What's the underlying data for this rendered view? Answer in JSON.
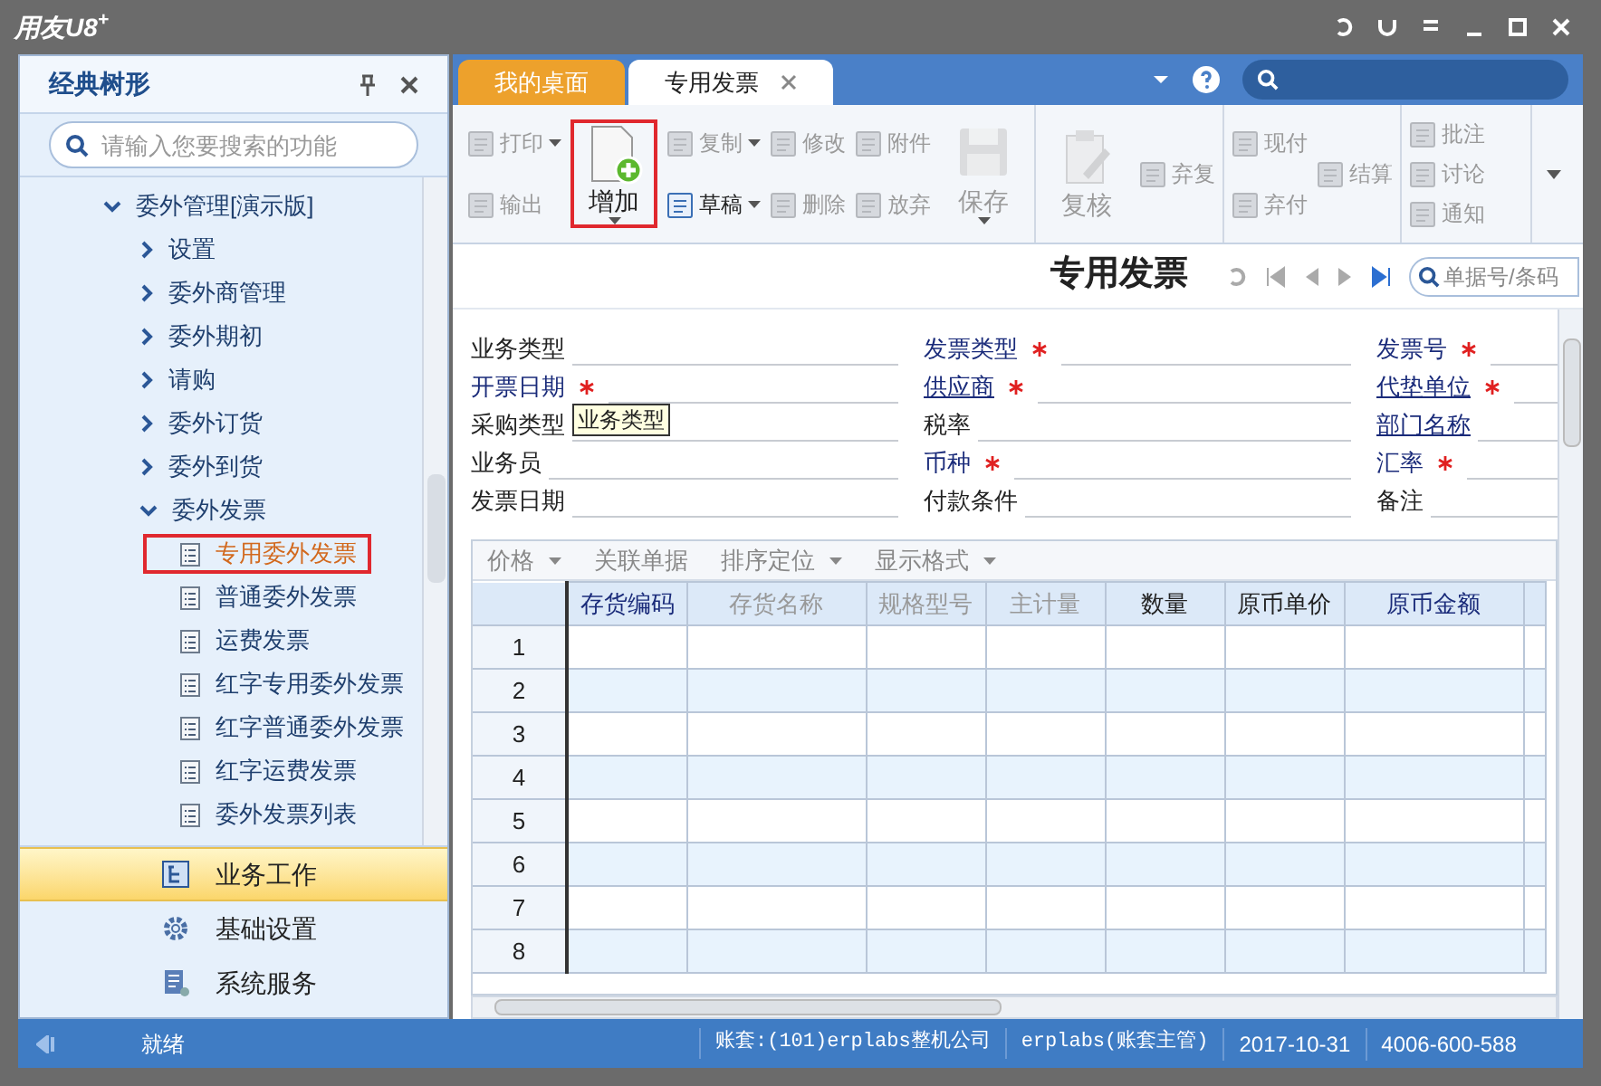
{
  "title_bar": {
    "app_title": "用友U8$^{+}$"
  },
  "sidebar": {
    "title": "经典树形",
    "search_placeholder": "请输入您要搜索的功能",
    "tree": [
      {
        "label": "委外管理[演示版]",
        "expanded": true,
        "children": [
          {
            "label": "设置",
            "expanded": false
          },
          {
            "label": "委外商管理",
            "expanded": false
          },
          {
            "label": "委外期初",
            "expanded": false
          },
          {
            "label": "请购",
            "expanded": false
          },
          {
            "label": "委外订货",
            "expanded": false
          },
          {
            "label": "委外到货",
            "expanded": false
          },
          {
            "label": "委外发票",
            "expanded": true,
            "children": [
              {
                "label": "专用委外发票",
                "kind": "document",
                "selected": true,
                "highlighted": true
              },
              {
                "label": "普通委外发票",
                "kind": "document",
                "selected": false,
                "highlighted": false
              },
              {
                "label": "运费发票",
                "kind": "document",
                "selected": false,
                "highlighted": false
              },
              {
                "label": "红字专用委外发票",
                "kind": "document",
                "selected": false,
                "highlighted": false
              },
              {
                "label": "红字普通委外发票",
                "kind": "document",
                "selected": false,
                "highlighted": false
              },
              {
                "label": "红字运费发票",
                "kind": "document",
                "selected": false,
                "highlighted": false
              },
              {
                "label": "委外发票列表",
                "kind": "document",
                "selected": false,
                "highlighted": false
              }
            ]
          }
        ]
      }
    ],
    "nav": [
      {
        "label": "业务工作",
        "selected": true
      },
      {
        "label": "基础设置",
        "selected": false
      },
      {
        "label": "系统服务",
        "selected": false
      }
    ]
  },
  "tabs": [
    {
      "label": "我的桌面",
      "selected": false
    },
    {
      "label": "专用发票",
      "selected": true
    }
  ],
  "toolbar": {
    "groups": [
      [
        [
          {
            "label": "打印",
            "kind": "small",
            "disabled": true,
            "dropdown": true
          },
          {
            "label": "输出",
            "kind": "small",
            "disabled": true,
            "dropdown": false
          }
        ],
        [
          {
            "label": "增加",
            "kind": "large",
            "disabled": false,
            "dropdown": true,
            "highlighted": true
          }
        ],
        [
          {
            "label": "复制",
            "kind": "small",
            "disabled": true,
            "dropdown": true
          },
          {
            "label": "草稿",
            "kind": "small",
            "disabled": false,
            "dropdown": true
          }
        ],
        [
          {
            "label": "修改",
            "kind": "small",
            "disabled": true,
            "dropdown": false
          },
          {
            "label": "删除",
            "kind": "small",
            "disabled": true,
            "dropdown": false
          }
        ],
        [
          {
            "label": "附件",
            "kind": "small",
            "disabled": true,
            "dropdown": false
          },
          {
            "label": "放弃",
            "kind": "small",
            "disabled": true,
            "dropdown": false
          }
        ],
        [
          {
            "label": "保存",
            "kind": "large",
            "disabled": true,
            "dropdown": true,
            "highlighted": false
          }
        ]
      ],
      [
        [
          {
            "label": "复核",
            "kind": "large",
            "disabled": true,
            "dropdown": false,
            "highlighted": false
          }
        ],
        [
          {
            "label": "弃复",
            "kind": "small",
            "disabled": true,
            "dropdown": false
          }
        ]
      ],
      [
        [
          {
            "label": "现付",
            "kind": "small",
            "disabled": true,
            "dropdown": false
          },
          {
            "label": "弃付",
            "kind": "small",
            "disabled": true,
            "dropdown": false
          }
        ],
        [
          {
            "label": "结算",
            "kind": "small",
            "disabled": true,
            "dropdown": false
          }
        ]
      ],
      [
        [
          {
            "label": "批注",
            "kind": "small",
            "disabled": true,
            "dropdown": false
          },
          {
            "label": "讨论",
            "kind": "small",
            "disabled": true,
            "dropdown": false
          },
          {
            "label": "通知",
            "kind": "small",
            "disabled": true,
            "dropdown": false
          }
        ]
      ]
    ]
  },
  "document": {
    "title": "专用发票",
    "search_placeholder": "单据号/条码"
  },
  "form": {
    "columns": [
      [
        {
          "label": "业务类型",
          "kind": "plain",
          "required": false
        },
        {
          "label": "开票日期",
          "kind": "emphasis",
          "required": true
        },
        {
          "label": "采购类型",
          "kind": "plain",
          "required": false
        },
        {
          "label": "业务员",
          "kind": "plain",
          "required": false
        },
        {
          "label": "发票日期",
          "kind": "plain",
          "required": false
        }
      ],
      [
        {
          "label": "发票类型",
          "kind": "emphasis",
          "required": true
        },
        {
          "label": "供应商",
          "kind": "link",
          "required": true
        },
        {
          "label": "税率",
          "kind": "plain",
          "required": false
        },
        {
          "label": "币种",
          "kind": "emphasis",
          "required": true
        },
        {
          "label": "付款条件",
          "kind": "plain",
          "required": false
        }
      ],
      [
        {
          "label": "发票号",
          "kind": "emphasis",
          "required": true
        },
        {
          "label": "代垫单位",
          "kind": "link",
          "required": true
        },
        {
          "label": "部门名称",
          "kind": "link",
          "required": false
        },
        {
          "label": "汇率",
          "kind": "emphasis",
          "required": true
        },
        {
          "label": "备注",
          "kind": "plain",
          "required": false
        }
      ]
    ],
    "tooltip": "业务类型"
  },
  "grid": {
    "menu": [
      {
        "label": "价格",
        "dropdown": true
      },
      {
        "label": "关联单据",
        "dropdown": false
      },
      {
        "label": "排序定位",
        "dropdown": true
      },
      {
        "label": "显示格式",
        "dropdown": true
      }
    ],
    "columns": [
      {
        "label": "存货编码",
        "kind": "key"
      },
      {
        "label": "存货名称",
        "kind": "readonly"
      },
      {
        "label": "规格型号",
        "kind": "readonly"
      },
      {
        "label": "主计量",
        "kind": "readonly"
      },
      {
        "label": "数量",
        "kind": "normal"
      },
      {
        "label": "原币单价",
        "kind": "normal"
      },
      {
        "label": "原币金额",
        "kind": "key"
      }
    ],
    "rows": [
      "1",
      "2",
      "3",
      "4",
      "5",
      "6",
      "7",
      "8"
    ]
  },
  "status_bar": {
    "state": "就绪",
    "account": "账套:(101)erplabs整机公司",
    "user": "erplabs(账套主管)",
    "date": "2017-10-31",
    "phone": "4006-600-588"
  }
}
